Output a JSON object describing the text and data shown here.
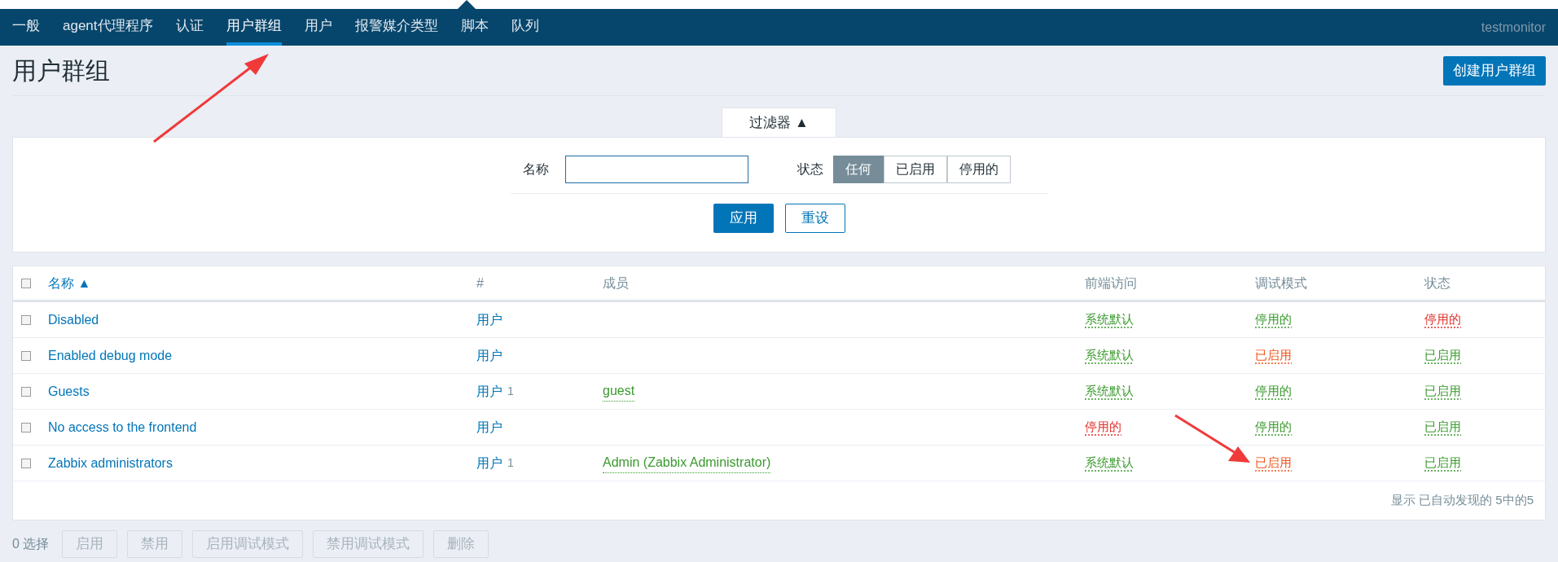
{
  "nav": {
    "items": [
      {
        "label": "一般",
        "selected": false
      },
      {
        "label": "agent代理程序",
        "selected": false
      },
      {
        "label": "认证",
        "selected": false
      },
      {
        "label": "用户群组",
        "selected": true
      },
      {
        "label": "用户",
        "selected": false
      },
      {
        "label": "报警媒介类型",
        "selected": false
      },
      {
        "label": "脚本",
        "selected": false
      },
      {
        "label": "队列",
        "selected": false
      }
    ],
    "user": "testmonitor"
  },
  "page": {
    "title": "用户群组",
    "create_button": "创建用户群组"
  },
  "filter": {
    "tab": "过滤器 ▲",
    "name_label": "名称",
    "status_label": "状态",
    "status_options": [
      {
        "label": "任何",
        "selected": true
      },
      {
        "label": "已启用",
        "selected": false
      },
      {
        "label": "停用的",
        "selected": false
      }
    ],
    "apply": "应用",
    "reset": "重设"
  },
  "table": {
    "select_all_checked": false,
    "columns": [
      "名称 ▲",
      "#",
      "成员",
      "前端访问",
      "调试模式",
      "状态"
    ],
    "rows": [
      {
        "checked": false,
        "name": "Disabled",
        "users": "用户",
        "count": "",
        "members": "",
        "frontend": {
          "text": "系统默认",
          "kind": "ok"
        },
        "debug": {
          "text": "停用的",
          "kind": "ok"
        },
        "status": {
          "text": "停用的",
          "kind": "error"
        }
      },
      {
        "checked": false,
        "name": "Enabled debug mode",
        "users": "用户",
        "count": "",
        "members": "",
        "frontend": {
          "text": "系统默认",
          "kind": "ok"
        },
        "debug": {
          "text": "已启用",
          "kind": "warning"
        },
        "status": {
          "text": "已启用",
          "kind": "ok"
        }
      },
      {
        "checked": false,
        "name": "Guests",
        "users": "用户",
        "count": "1",
        "members": "guest",
        "frontend": {
          "text": "系统默认",
          "kind": "ok"
        },
        "debug": {
          "text": "停用的",
          "kind": "ok"
        },
        "status": {
          "text": "已启用",
          "kind": "ok"
        }
      },
      {
        "checked": false,
        "name": "No access to the frontend",
        "users": "用户",
        "count": "",
        "members": "",
        "frontend": {
          "text": "停用的",
          "kind": "error"
        },
        "debug": {
          "text": "停用的",
          "kind": "ok"
        },
        "status": {
          "text": "已启用",
          "kind": "ok"
        }
      },
      {
        "checked": false,
        "name": "Zabbix administrators",
        "users": "用户",
        "count": "1",
        "members": "Admin (Zabbix Administrator)",
        "frontend": {
          "text": "系统默认",
          "kind": "ok"
        },
        "debug": {
          "text": "已启用",
          "kind": "warning"
        },
        "status": {
          "text": "已启用",
          "kind": "ok"
        }
      }
    ],
    "footer": "显示 已自动发现的 5中的5"
  },
  "actions": {
    "selected_count": "0 选择",
    "buttons": [
      {
        "label": "启用",
        "disabled": true
      },
      {
        "label": "禁用",
        "disabled": true
      },
      {
        "label": "启用调试模式",
        "disabled": true
      },
      {
        "label": "禁用调试模式",
        "disabled": true
      },
      {
        "label": "删除",
        "disabled": true
      }
    ]
  }
}
